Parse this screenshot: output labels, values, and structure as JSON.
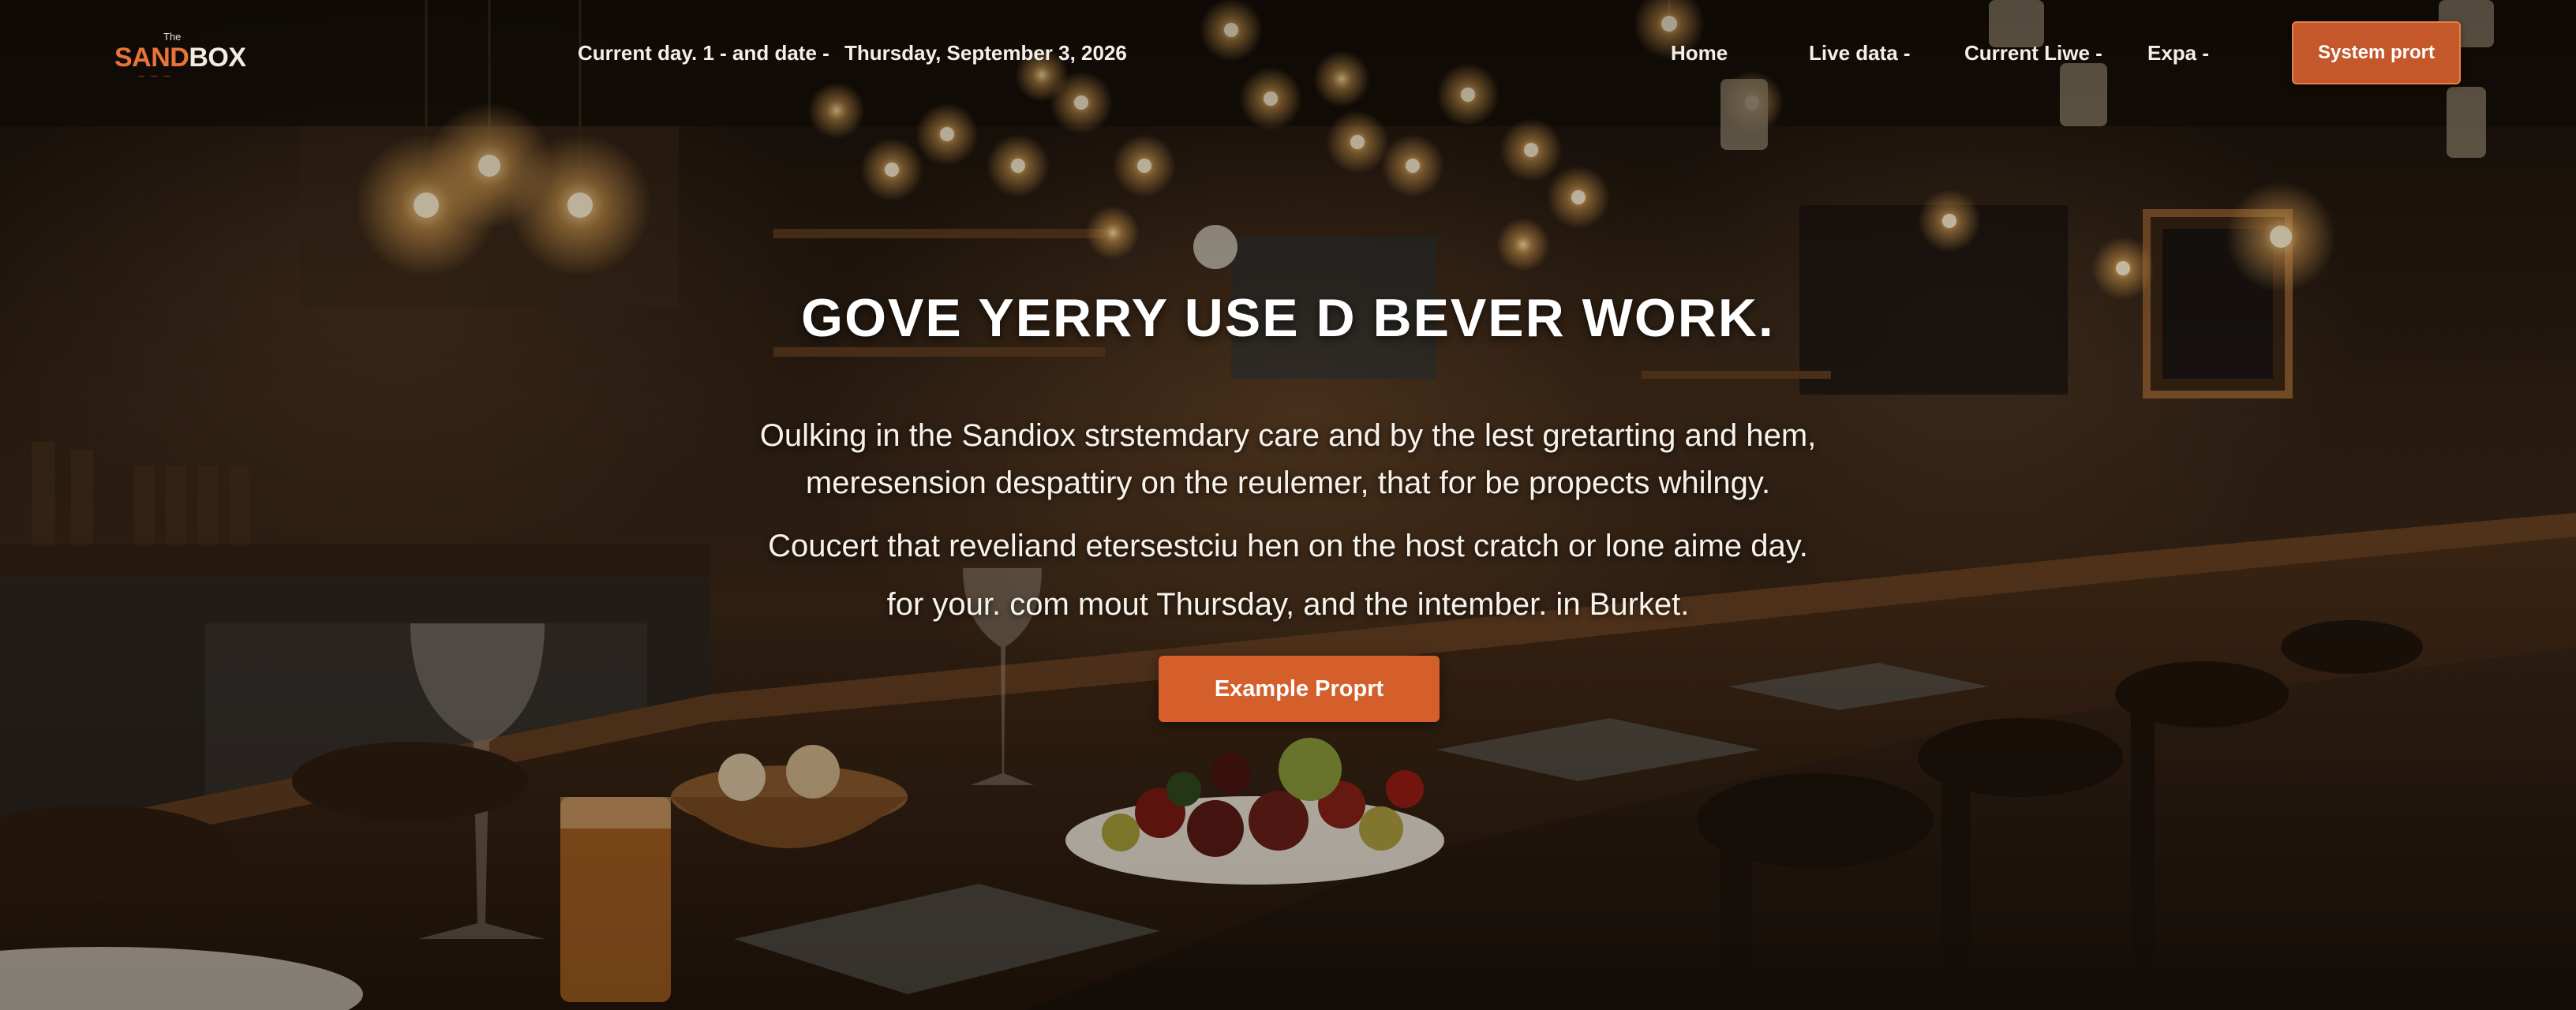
{
  "brand": {
    "the": "The",
    "sand": "SAND",
    "box": "BOX",
    "sub": "— — —"
  },
  "nav": {
    "date_label": "Current day. 1 - and date -",
    "date_value": "Thursday, September 3, 2026",
    "links": [
      "Home",
      "Live data -",
      "Current Liwe -",
      "Expa -"
    ],
    "cta": "System prort"
  },
  "hero": {
    "title": "GOVE YERRY USE D BEVER WORK.",
    "lines": [
      "Oulking in the Sandiox strstemdary care and by the lest gretarting and hem,",
      "meresension despattiry on the reulemer, that for be propects whilngy.",
      "Coucert that reveliand etersestciu hen on the host cratch or lone aime day.",
      "for your. com mout Thursday, and the intember. in Burket."
    ],
    "cta": "Example Proprt"
  },
  "colors": {
    "accent": "#d45f2a",
    "brand_orange": "#e8743a",
    "text": "#f4efe8"
  }
}
